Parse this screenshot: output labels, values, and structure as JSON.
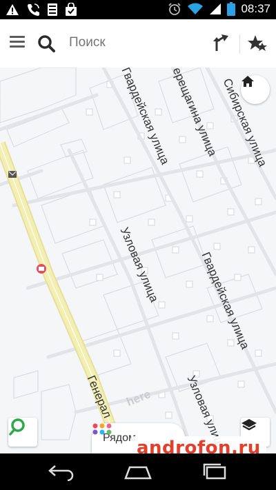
{
  "status_bar": {
    "time": "08:37",
    "left_icons": [
      "warning-icon",
      "phone-icon",
      "sim-icon",
      "bag-icon"
    ],
    "right_icons": [
      "alarm-icon",
      "wifi-icon",
      "signal-icon",
      "battery-icon"
    ]
  },
  "search": {
    "placeholder": "Поиск"
  },
  "map": {
    "streets": {
      "gvardeyskaya_1": "Гвардейская улица",
      "vereshchagina": "ерещагина улица",
      "sibirskaya": "Сибирская улица",
      "uzlovaya_1": "Узловая улица",
      "gvardeyskaya_2": "Гвардейская улица",
      "uzlovaya_2": "Узловая улица",
      "general": "Генерал"
    },
    "brand_logo": "here"
  },
  "nearby_button": {
    "label": "Рядом"
  },
  "watermark": "androfon.ru",
  "colors": {
    "accent_green": "#2aa84a",
    "map_bg": "#f4f6f8",
    "main_road": "#f3efb0",
    "watermark_red": "#e2402a"
  }
}
